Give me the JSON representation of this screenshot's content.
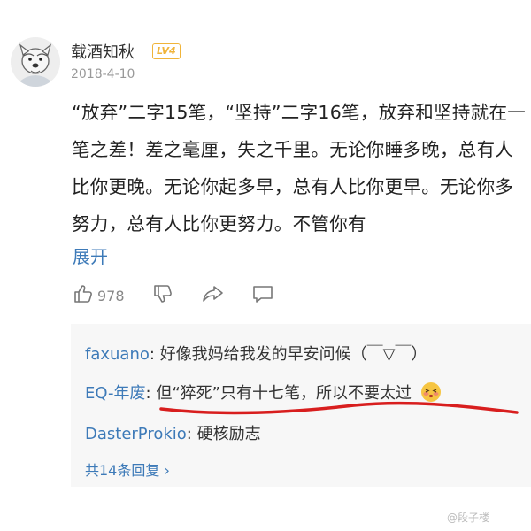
{
  "post": {
    "username": "载酒知秋",
    "level_badge": "LV4",
    "date": "2018-4-10",
    "content": "“放弃”二字15笔，“坚持”二字16笔，放弃和坚持就在一笔之差！差之毫厘，失之千里。无论你睡多晚，总有人比你更晚。无论你起多早，总有人比你更早。无论你多努力，总有人比你更努力。不管你有",
    "expand_label": "展开"
  },
  "actions": {
    "like_count": "978",
    "like_icon": "thumbs-up-icon",
    "dislike_icon": "thumbs-down-icon",
    "share_icon": "share-icon",
    "comment_icon": "comment-icon"
  },
  "replies": [
    {
      "name": "faxuano",
      "separator": ": ",
      "text": "好像我妈给我发的早安问候（￣▽￣）"
    },
    {
      "name": "EQ-年废",
      "separator": ": ",
      "text": "但“猝死”只有十七笔，所以不要太过"
    },
    {
      "name": "DasterProkio",
      "separator": ": ",
      "text": "硬核励志"
    }
  ],
  "more_replies_label": "共14条回复 ›",
  "watermark": "@段子楼",
  "colors": {
    "link": "#3d7ab8",
    "underline": "#d81e1e",
    "badge": "#f0b43a"
  }
}
